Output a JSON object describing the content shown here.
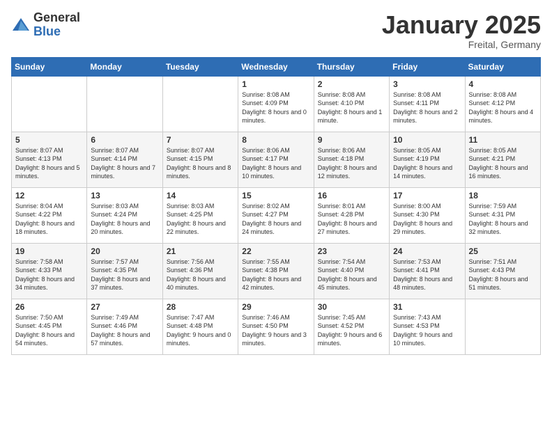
{
  "header": {
    "logo_general": "General",
    "logo_blue": "Blue",
    "month_title": "January 2025",
    "location": "Freital, Germany"
  },
  "days_of_week": [
    "Sunday",
    "Monday",
    "Tuesday",
    "Wednesday",
    "Thursday",
    "Friday",
    "Saturday"
  ],
  "weeks": [
    [
      {
        "day": null
      },
      {
        "day": null
      },
      {
        "day": null
      },
      {
        "day": "1",
        "sunrise": "Sunrise: 8:08 AM",
        "sunset": "Sunset: 4:09 PM",
        "daylight": "Daylight: 8 hours and 0 minutes."
      },
      {
        "day": "2",
        "sunrise": "Sunrise: 8:08 AM",
        "sunset": "Sunset: 4:10 PM",
        "daylight": "Daylight: 8 hours and 1 minute."
      },
      {
        "day": "3",
        "sunrise": "Sunrise: 8:08 AM",
        "sunset": "Sunset: 4:11 PM",
        "daylight": "Daylight: 8 hours and 2 minutes."
      },
      {
        "day": "4",
        "sunrise": "Sunrise: 8:08 AM",
        "sunset": "Sunset: 4:12 PM",
        "daylight": "Daylight: 8 hours and 4 minutes."
      }
    ],
    [
      {
        "day": "5",
        "sunrise": "Sunrise: 8:07 AM",
        "sunset": "Sunset: 4:13 PM",
        "daylight": "Daylight: 8 hours and 5 minutes."
      },
      {
        "day": "6",
        "sunrise": "Sunrise: 8:07 AM",
        "sunset": "Sunset: 4:14 PM",
        "daylight": "Daylight: 8 hours and 7 minutes."
      },
      {
        "day": "7",
        "sunrise": "Sunrise: 8:07 AM",
        "sunset": "Sunset: 4:15 PM",
        "daylight": "Daylight: 8 hours and 8 minutes."
      },
      {
        "day": "8",
        "sunrise": "Sunrise: 8:06 AM",
        "sunset": "Sunset: 4:17 PM",
        "daylight": "Daylight: 8 hours and 10 minutes."
      },
      {
        "day": "9",
        "sunrise": "Sunrise: 8:06 AM",
        "sunset": "Sunset: 4:18 PM",
        "daylight": "Daylight: 8 hours and 12 minutes."
      },
      {
        "day": "10",
        "sunrise": "Sunrise: 8:05 AM",
        "sunset": "Sunset: 4:19 PM",
        "daylight": "Daylight: 8 hours and 14 minutes."
      },
      {
        "day": "11",
        "sunrise": "Sunrise: 8:05 AM",
        "sunset": "Sunset: 4:21 PM",
        "daylight": "Daylight: 8 hours and 16 minutes."
      }
    ],
    [
      {
        "day": "12",
        "sunrise": "Sunrise: 8:04 AM",
        "sunset": "Sunset: 4:22 PM",
        "daylight": "Daylight: 8 hours and 18 minutes."
      },
      {
        "day": "13",
        "sunrise": "Sunrise: 8:03 AM",
        "sunset": "Sunset: 4:24 PM",
        "daylight": "Daylight: 8 hours and 20 minutes."
      },
      {
        "day": "14",
        "sunrise": "Sunrise: 8:03 AM",
        "sunset": "Sunset: 4:25 PM",
        "daylight": "Daylight: 8 hours and 22 minutes."
      },
      {
        "day": "15",
        "sunrise": "Sunrise: 8:02 AM",
        "sunset": "Sunset: 4:27 PM",
        "daylight": "Daylight: 8 hours and 24 minutes."
      },
      {
        "day": "16",
        "sunrise": "Sunrise: 8:01 AM",
        "sunset": "Sunset: 4:28 PM",
        "daylight": "Daylight: 8 hours and 27 minutes."
      },
      {
        "day": "17",
        "sunrise": "Sunrise: 8:00 AM",
        "sunset": "Sunset: 4:30 PM",
        "daylight": "Daylight: 8 hours and 29 minutes."
      },
      {
        "day": "18",
        "sunrise": "Sunrise: 7:59 AM",
        "sunset": "Sunset: 4:31 PM",
        "daylight": "Daylight: 8 hours and 32 minutes."
      }
    ],
    [
      {
        "day": "19",
        "sunrise": "Sunrise: 7:58 AM",
        "sunset": "Sunset: 4:33 PM",
        "daylight": "Daylight: 8 hours and 34 minutes."
      },
      {
        "day": "20",
        "sunrise": "Sunrise: 7:57 AM",
        "sunset": "Sunset: 4:35 PM",
        "daylight": "Daylight: 8 hours and 37 minutes."
      },
      {
        "day": "21",
        "sunrise": "Sunrise: 7:56 AM",
        "sunset": "Sunset: 4:36 PM",
        "daylight": "Daylight: 8 hours and 40 minutes."
      },
      {
        "day": "22",
        "sunrise": "Sunrise: 7:55 AM",
        "sunset": "Sunset: 4:38 PM",
        "daylight": "Daylight: 8 hours and 42 minutes."
      },
      {
        "day": "23",
        "sunrise": "Sunrise: 7:54 AM",
        "sunset": "Sunset: 4:40 PM",
        "daylight": "Daylight: 8 hours and 45 minutes."
      },
      {
        "day": "24",
        "sunrise": "Sunrise: 7:53 AM",
        "sunset": "Sunset: 4:41 PM",
        "daylight": "Daylight: 8 hours and 48 minutes."
      },
      {
        "day": "25",
        "sunrise": "Sunrise: 7:51 AM",
        "sunset": "Sunset: 4:43 PM",
        "daylight": "Daylight: 8 hours and 51 minutes."
      }
    ],
    [
      {
        "day": "26",
        "sunrise": "Sunrise: 7:50 AM",
        "sunset": "Sunset: 4:45 PM",
        "daylight": "Daylight: 8 hours and 54 minutes."
      },
      {
        "day": "27",
        "sunrise": "Sunrise: 7:49 AM",
        "sunset": "Sunset: 4:46 PM",
        "daylight": "Daylight: 8 hours and 57 minutes."
      },
      {
        "day": "28",
        "sunrise": "Sunrise: 7:47 AM",
        "sunset": "Sunset: 4:48 PM",
        "daylight": "Daylight: 9 hours and 0 minutes."
      },
      {
        "day": "29",
        "sunrise": "Sunrise: 7:46 AM",
        "sunset": "Sunset: 4:50 PM",
        "daylight": "Daylight: 9 hours and 3 minutes."
      },
      {
        "day": "30",
        "sunrise": "Sunrise: 7:45 AM",
        "sunset": "Sunset: 4:52 PM",
        "daylight": "Daylight: 9 hours and 6 minutes."
      },
      {
        "day": "31",
        "sunrise": "Sunrise: 7:43 AM",
        "sunset": "Sunset: 4:53 PM",
        "daylight": "Daylight: 9 hours and 10 minutes."
      },
      {
        "day": null
      }
    ]
  ]
}
